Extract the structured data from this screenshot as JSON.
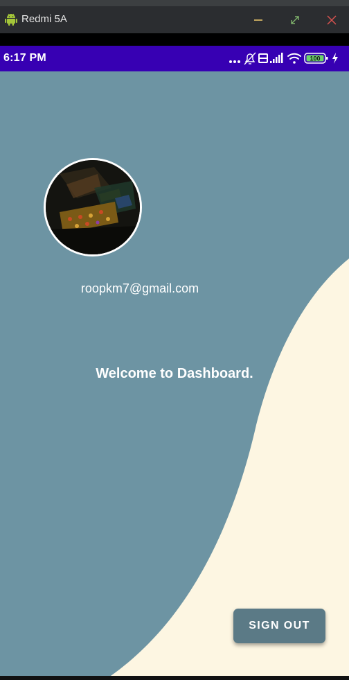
{
  "window": {
    "title": "Redmi 5A",
    "icons": [
      "android-icon",
      "minimize-icon",
      "maximize-icon",
      "close-icon"
    ]
  },
  "status_bar": {
    "time": "6:17 PM",
    "battery": "100",
    "icons": [
      "more-dots-icon",
      "bell-off-icon",
      "volte-icon",
      "signal-icon",
      "wifi-icon",
      "battery-icon",
      "charging-icon"
    ]
  },
  "dashboard": {
    "email": "roopkm7@gmail.com",
    "welcome": "Welcome to Dashboard.",
    "sign_out_label": "SIGN OUT"
  },
  "colors": {
    "status_bar": "#3700b3",
    "background": "#6d94a3",
    "wave": "#fdf6e2",
    "button": "#5b7a86"
  }
}
